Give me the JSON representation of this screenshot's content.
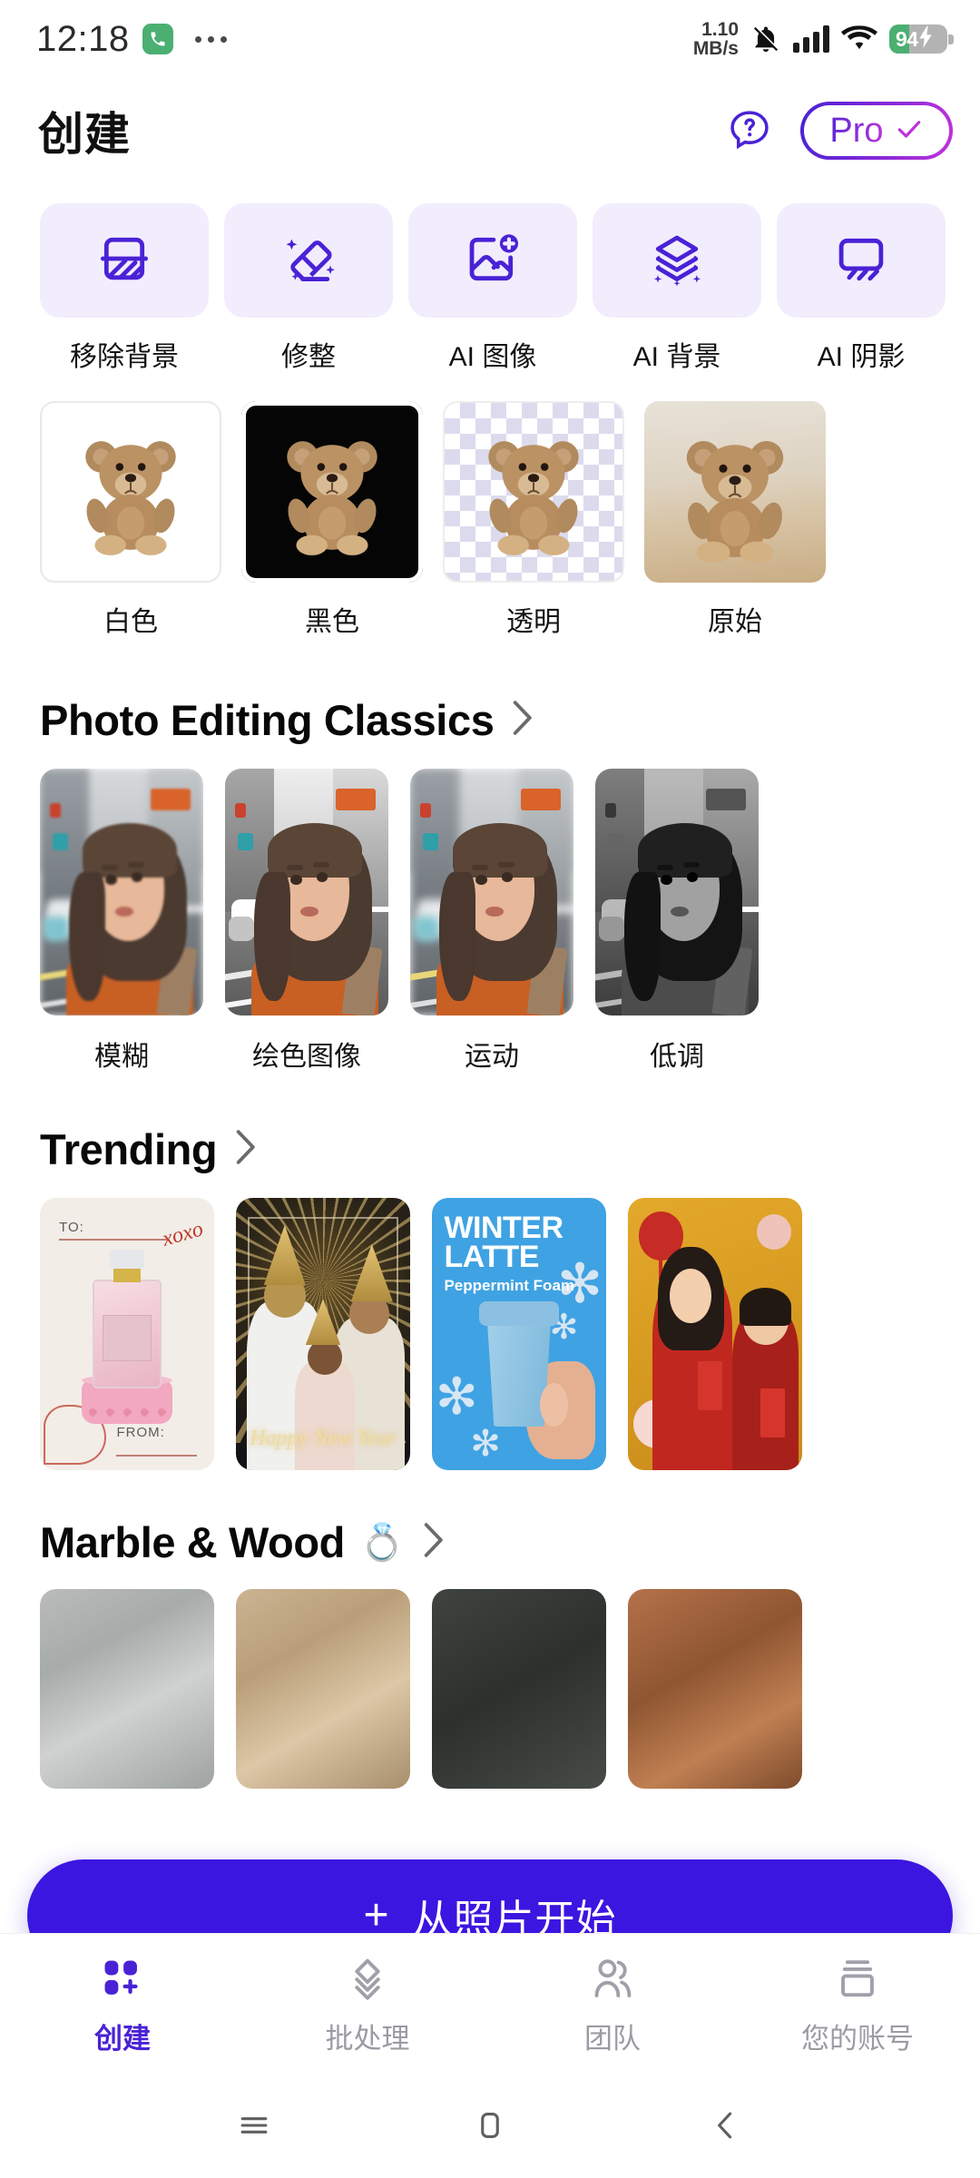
{
  "status_bar": {
    "time": "12:18",
    "call_icon": "phone-icon",
    "more_icon": "more-dots-icon",
    "network_speed": "1.10",
    "network_speed_unit": "MB/s",
    "mute_icon": "bell-muted-icon",
    "signal_icon": "signal-bars-icon",
    "wifi_icon": "wifi-icon",
    "battery_level": "94",
    "battery_charging": true
  },
  "header": {
    "title": "创建",
    "help_icon": "help-chat-icon",
    "pro_label": "Pro",
    "pro_check_icon": "check-icon"
  },
  "tools": [
    {
      "label": "移除背景",
      "icon": "remove-background-icon"
    },
    {
      "label": "修整",
      "icon": "eraser-retouch-icon"
    },
    {
      "label": "AI 图像",
      "icon": "ai-image-add-icon"
    },
    {
      "label": "AI 背景",
      "icon": "ai-background-layers-icon"
    },
    {
      "label": "AI 阴影",
      "icon": "ai-shadow-icon"
    }
  ],
  "background_options": [
    {
      "label": "白色",
      "style": "white",
      "selected": false
    },
    {
      "label": "黑色",
      "style": "black",
      "selected": true
    },
    {
      "label": "透明",
      "style": "transparent",
      "selected": false
    },
    {
      "label": "原始",
      "style": "original",
      "selected": false
    }
  ],
  "sections": [
    {
      "title": "Photo Editing Classics",
      "emoji": "",
      "chevron_icon": "chevron-right-icon",
      "items": [
        {
          "label": "模糊",
          "filter": "blur"
        },
        {
          "label": "绘色图像",
          "filter": "colorize"
        },
        {
          "label": "运动",
          "filter": "motion"
        },
        {
          "label": "低调",
          "filter": "lowkey"
        }
      ]
    },
    {
      "title": "Trending",
      "emoji": "",
      "chevron_icon": "chevron-right-icon",
      "cards": [
        {
          "name": "perfume-valentine-card",
          "to_label": "TO:",
          "from_label": "FROM:",
          "accent_text": "xoxo"
        },
        {
          "name": "new-year-family-card",
          "caption": "Happy New Year"
        },
        {
          "name": "winter-latte-card",
          "title_line1": "WINTER",
          "title_line2": "LATTE",
          "subtitle": "Peppermint Foam"
        },
        {
          "name": "chinese-new-year-card",
          "caption": ""
        }
      ]
    },
    {
      "title": "Marble & Wood",
      "emoji": "💍",
      "chevron_icon": "chevron-right-icon",
      "swatches": [
        {
          "name": "gray-marble"
        },
        {
          "name": "light-wood"
        },
        {
          "name": "dark-slate"
        },
        {
          "name": "brown-wood"
        }
      ]
    }
  ],
  "cta": {
    "plus_icon": "plus-icon",
    "label": "从照片开始"
  },
  "bottom_nav": [
    {
      "label": "创建",
      "icon": "create-grid-icon",
      "active": true
    },
    {
      "label": "批处理",
      "icon": "batch-layers-icon",
      "active": false
    },
    {
      "label": "团队",
      "icon": "team-people-icon",
      "active": false
    },
    {
      "label": "您的账号",
      "icon": "account-card-icon",
      "active": false
    }
  ],
  "system_nav": [
    {
      "name": "recents-button",
      "icon": "menu-lines-icon"
    },
    {
      "name": "home-button",
      "icon": "home-square-icon"
    },
    {
      "name": "back-button",
      "icon": "chevron-left-icon"
    }
  ],
  "colors": {
    "brand_purple": "#4a22d6",
    "cta_blue": "#3b16e0",
    "tool_card_bg": "#f2edfd",
    "inactive_gray": "#9b9ba5"
  }
}
